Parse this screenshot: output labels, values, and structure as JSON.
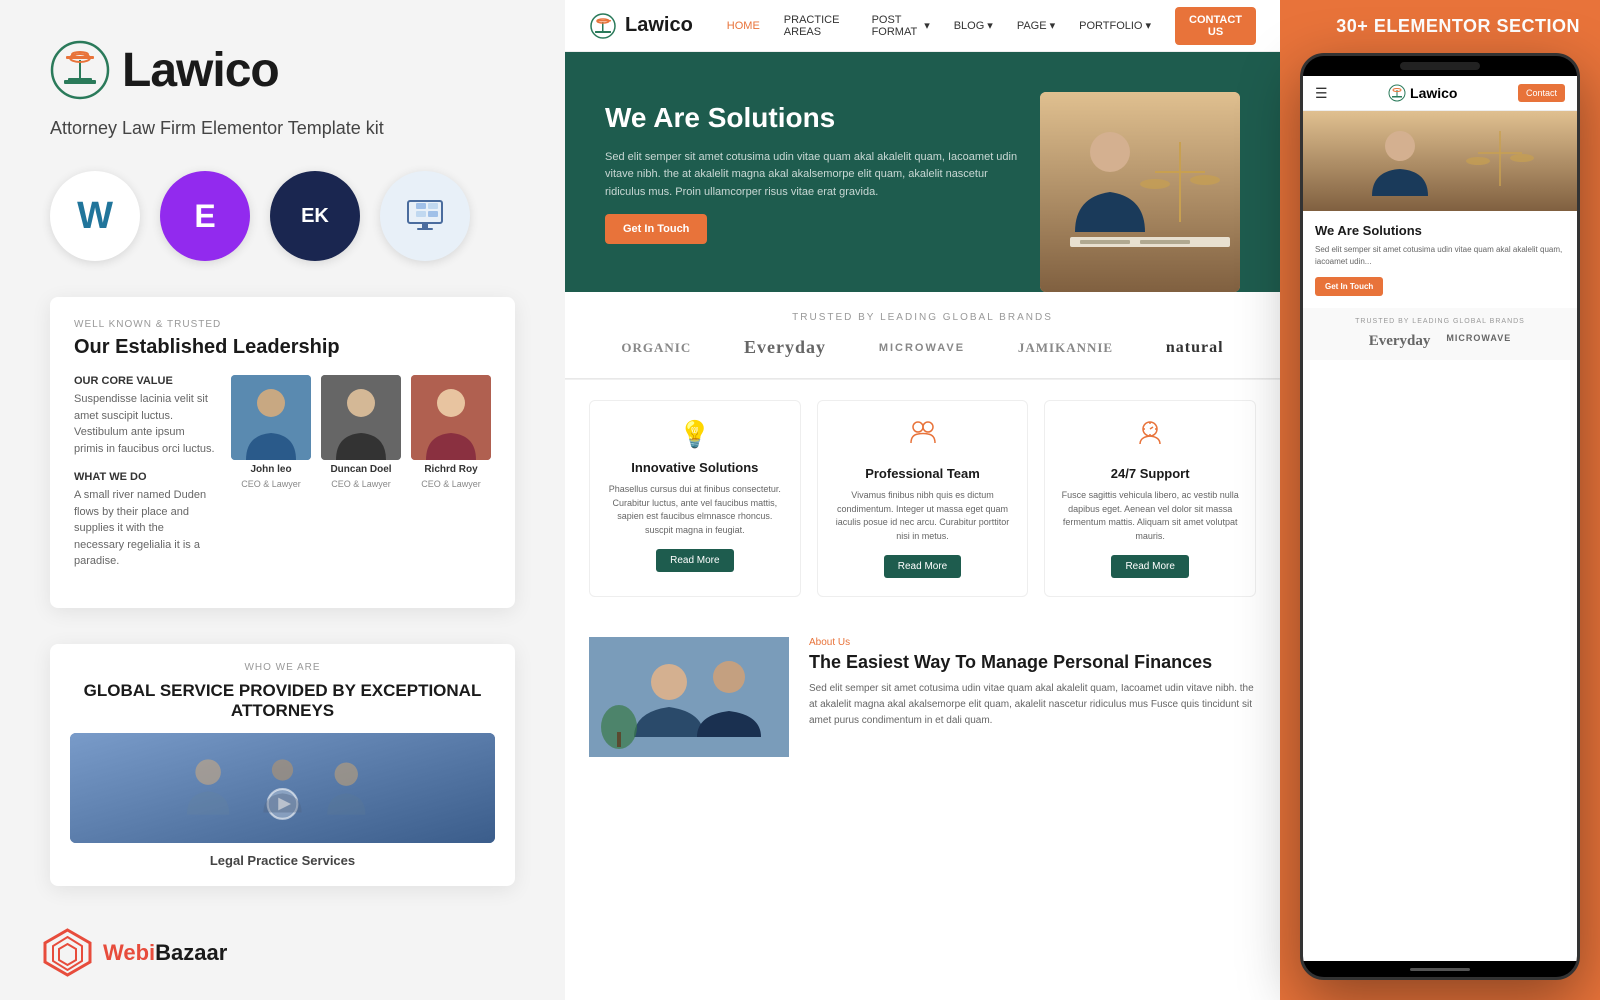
{
  "left": {
    "logo": "Lawico",
    "tagline": "Attorney Law Firm Elementor Template kit",
    "tech_icons": [
      {
        "name": "WordPress",
        "symbol": "W",
        "bg": "#fff",
        "color": "#21759b"
      },
      {
        "name": "Elementor",
        "symbol": "E",
        "bg": "#922aee",
        "color": "#fff"
      },
      {
        "name": "ElementsKit",
        "symbol": "EK",
        "bg": "#1a2650",
        "color": "#fff"
      },
      {
        "name": "Monitor",
        "symbol": "⊟",
        "bg": "#e8f0f8",
        "color": "#4a6c9e"
      }
    ],
    "leadership": {
      "label": "WELL KNOWN & TRUSTED",
      "title": "Our Established Leadership",
      "core_value_label": "OUR CORE VALUE",
      "core_value_text": "Suspendisse lacinia velit sit amet suscipit luctus. Vestibulum ante ipsum primis in faucibus orci luctus.",
      "what_we_do_label": "WHAT WE DO",
      "what_we_do_text": "A small river named Duden flows by their place and supplies it with the necessary regelialia it is a paradise.",
      "team": [
        {
          "name": "John leo",
          "role": "CEO & Lawyer"
        },
        {
          "name": "Duncan Doel",
          "role": "CEO & Lawyer"
        },
        {
          "name": "Richrd Roy",
          "role": "CEO & Lawyer"
        }
      ]
    },
    "global": {
      "who_we_are": "WHO WE ARE",
      "title": "GLOBAL SERVICE PROVIDED BY EXCEPTIONAL ATTORNEYS",
      "legal_practice": "Legal Practice Services"
    },
    "webibazaar": {
      "brand": "WebiBazaar",
      "brand_color": "#e74c3c"
    }
  },
  "desktop": {
    "navbar": {
      "logo": "Lawico",
      "links": [
        "HOME",
        "PRACTICE AREAS",
        "POST FORMAT",
        "BLOG",
        "PAGE",
        "PORTFOLIO"
      ],
      "cta": "CONTACT US"
    },
    "hero": {
      "title": "We Are Solutions",
      "description": "Sed elit semper sit amet cotusima udin vitae quam akal akalelit quam, Iacoamet udin vitave nibh. the at akalelit magna akal akalsemorpe elit quam, akalelit nascetur ridiculus mus. Proin ullamcorper risus vitae erat gravida.",
      "button": "Get In Touch"
    },
    "brands": {
      "label": "TRUSTED BY LEADING GLOBAL BRANDS",
      "list": [
        "ORGANIC",
        "Everyday",
        "MICROWAVE",
        "JAMIKANNIE",
        "natural"
      ]
    },
    "services": [
      {
        "icon": "💡",
        "title": "Innovative Solutions",
        "desc": "Phasellus cursus dui at finibus consectetur. Curabitur luctus, ante vel faucibus mattis, sapien est faucibus elmnasce rhoncus. suscpit magna in feugiat.",
        "button": "Read More"
      },
      {
        "icon": "👥",
        "title": "Professional Team",
        "desc": "Vivamus finibus nibh quis es dictum condimentum. Integer ut massa eget quam iaculis posue id nec arcu. Curabitur porttitor nisi in metus.",
        "button": "Read More"
      },
      {
        "icon": "🕐",
        "title": "24/7 Support",
        "desc": "Fusce sagittis vehicula libero, ac vestib nulla dapibus eget. Aenean vel dolor sit massa fermentum mattis. Aliquam sit amet volutpat mauris.",
        "button": "Read More"
      }
    ],
    "about": {
      "label": "About Us",
      "title": "The Easiest Way To Manage Personal Finances",
      "desc": "Sed elit semper sit amet cotusima udin vitae quam akal akalelit quam, Iacoamet udin vitave nibh. the at akalelit magna akal akalsemorpe elit quam, akalelit nascetur ridiculus mus Fusce quis tincidunt sit amet purus condimentum in et dali quam."
    }
  },
  "right": {
    "badge": "30+ ELEMENTOR SECTION",
    "mobile": {
      "navbar": {
        "logo": "Lawico",
        "cta": "Contact"
      },
      "hero": {
        "title": "We Are Solutions",
        "desc": "Sed elit semper sit amet cotusima udin vitae quam akal akalelit quam, iacoamet udin...",
        "button": "Get In Touch"
      },
      "brands_label": "TRUSTED BY LEADING GLOBAL BRANDS",
      "brands": [
        "Everyday",
        "MICROWAVE"
      ]
    }
  }
}
